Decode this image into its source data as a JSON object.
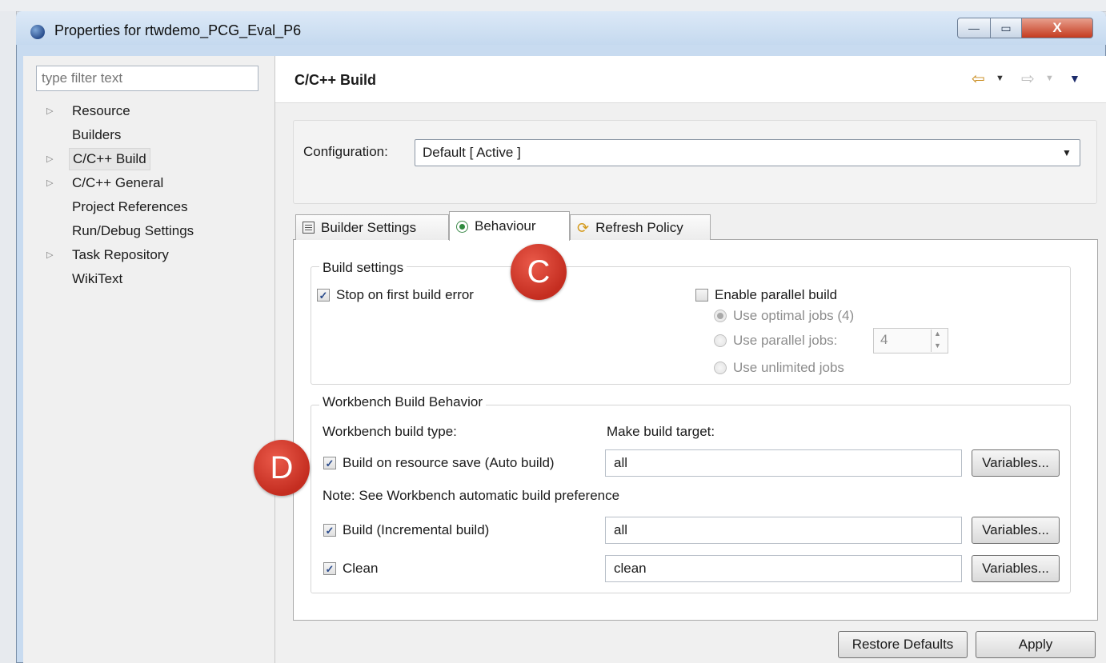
{
  "window": {
    "title": "Properties for rtwdemo_PCG_Eval_P6",
    "controls": {
      "minimize": "—",
      "maximize": "▭",
      "close": "X"
    }
  },
  "sidebar": {
    "filter_placeholder": "type filter text",
    "items": [
      {
        "label": "Resource",
        "expandable": true
      },
      {
        "label": "Builders",
        "expandable": false
      },
      {
        "label": "C/C++ Build",
        "expandable": true,
        "selected": true
      },
      {
        "label": "C/C++ General",
        "expandable": true
      },
      {
        "label": "Project References",
        "expandable": false
      },
      {
        "label": "Run/Debug Settings",
        "expandable": false
      },
      {
        "label": "Task Repository",
        "expandable": true
      },
      {
        "label": "WikiText",
        "expandable": false
      }
    ]
  },
  "page": {
    "title": "C/C++ Build",
    "nav_icons": [
      "back-arrow-icon",
      "forward-arrow-icon",
      "view-menu-icon"
    ]
  },
  "configuration": {
    "label": "Configuration:",
    "value": "Default  [ Active ]"
  },
  "tabs": [
    {
      "label": "Builder Settings",
      "icon": "list-icon",
      "active": false
    },
    {
      "label": "Behaviour",
      "icon": "radio-icon",
      "active": true
    },
    {
      "label": "Refresh Policy",
      "icon": "refresh-icon",
      "active": false
    }
  ],
  "build_settings": {
    "title": "Build settings",
    "stop_on_error": {
      "label": "Stop on first build error",
      "checked": true
    },
    "parallel": {
      "label": "Enable parallel build",
      "checked": false
    },
    "optimal_jobs": {
      "label": "Use optimal jobs (4)",
      "selected": true,
      "enabled": false
    },
    "parallel_jobs": {
      "label": "Use parallel jobs:",
      "value": "4",
      "selected": false,
      "enabled": false
    },
    "unlimited_jobs": {
      "label": "Use unlimited jobs",
      "selected": false,
      "enabled": false
    }
  },
  "workbench": {
    "title": "Workbench Build Behavior",
    "type_header": "Workbench build type:",
    "target_header": "Make build target:",
    "auto_build": {
      "label": "Build on resource save (Auto build)",
      "checked": true,
      "target": "all"
    },
    "note": "Note: See Workbench automatic build preference",
    "incremental": {
      "label": "Build (Incremental build)",
      "checked": true,
      "target": "all"
    },
    "clean": {
      "label": "Clean",
      "checked": true,
      "target": "clean"
    },
    "variables_label": "Variables..."
  },
  "callouts": {
    "c": "C",
    "d": "D",
    "color": "#d33a2c"
  },
  "footer": {
    "restore": "Restore Defaults",
    "apply": "Apply"
  }
}
